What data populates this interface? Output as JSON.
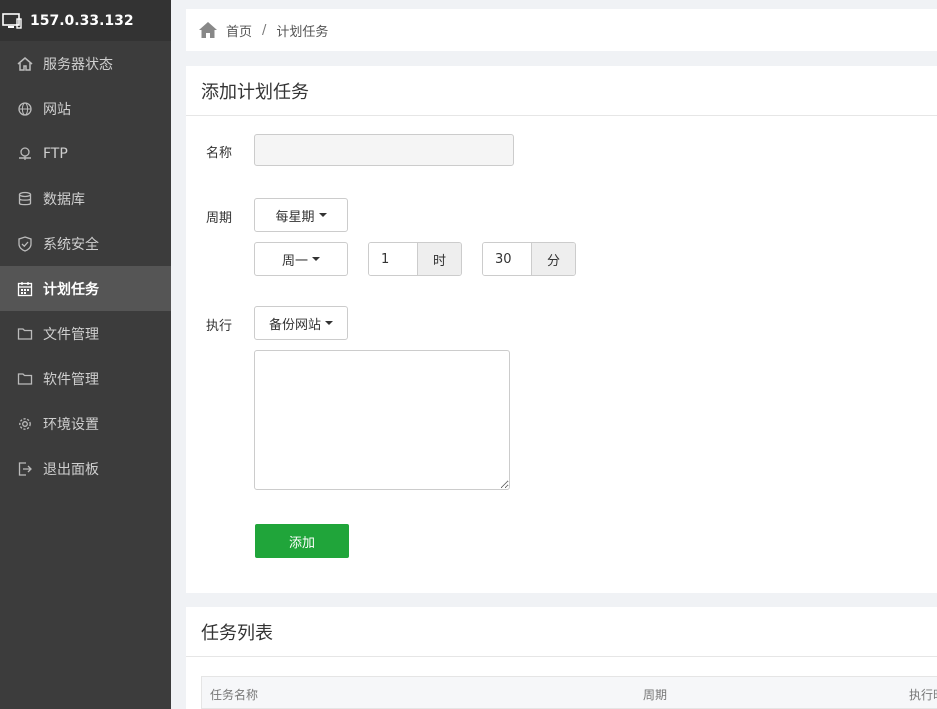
{
  "sidebar": {
    "host": "157.0.33.132",
    "items": [
      {
        "label": "服务器状态",
        "icon": "home-icon"
      },
      {
        "label": "网站",
        "icon": "globe-icon"
      },
      {
        "label": "FTP",
        "icon": "ftp-icon"
      },
      {
        "label": "数据库",
        "icon": "database-icon"
      },
      {
        "label": "系统安全",
        "icon": "shield-icon"
      },
      {
        "label": "计划任务",
        "icon": "calendar-icon",
        "active": true
      },
      {
        "label": "文件管理",
        "icon": "folder-icon"
      },
      {
        "label": "软件管理",
        "icon": "folder-icon"
      },
      {
        "label": "环境设置",
        "icon": "gear-icon"
      },
      {
        "label": "退出面板",
        "icon": "logout-icon"
      }
    ]
  },
  "breadcrumb": {
    "home": "首页",
    "separator": "/",
    "current": "计划任务"
  },
  "add_task": {
    "title": "添加计划任务",
    "name_label": "名称",
    "name_value": "",
    "cycle_label": "周期",
    "cycle_type": "每星期",
    "weekday": "周一",
    "hour_value": "1",
    "hour_unit": "时",
    "minute_value": "30",
    "minute_unit": "分",
    "exec_label": "执行",
    "exec_type": "备份网站",
    "script_value": "",
    "add_button": "添加"
  },
  "task_list": {
    "title": "任务列表",
    "columns": [
      "任务名称",
      "周期",
      "执行时"
    ]
  },
  "colors": {
    "sidebar_bg": "#3c3c3c",
    "sidebar_active": "#555555",
    "primary_green": "#20a53a"
  }
}
